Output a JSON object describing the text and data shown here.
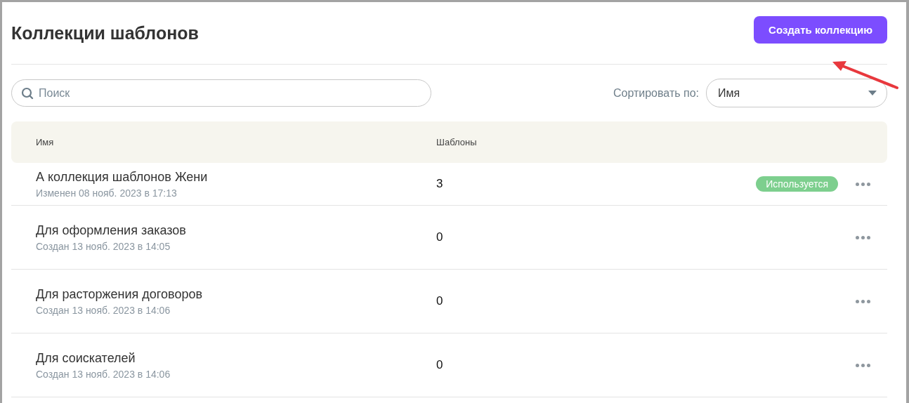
{
  "title": "Коллекции шаблонов",
  "create_button": "Создать коллекцию",
  "search": {
    "placeholder": "Поиск"
  },
  "sort": {
    "label": "Сортировать по:",
    "value": "Имя"
  },
  "table": {
    "columns": [
      "Имя",
      "Шаблоны"
    ],
    "rows": [
      {
        "name": "А коллекция шаблонов Жени",
        "meta": "Изменен 08 нояб. 2023 в 17:13",
        "count": "3",
        "badge": "Используется"
      },
      {
        "name": "Для оформления заказов",
        "meta": "Создан 13 нояб. 2023 в 14:05",
        "count": "0"
      },
      {
        "name": "Для расторжения договоров",
        "meta": "Создан 13 нояб. 2023 в 14:06",
        "count": "0"
      },
      {
        "name": "Для соискателей",
        "meta": "Создан 13 нояб. 2023 в 14:06",
        "count": "0"
      }
    ]
  }
}
